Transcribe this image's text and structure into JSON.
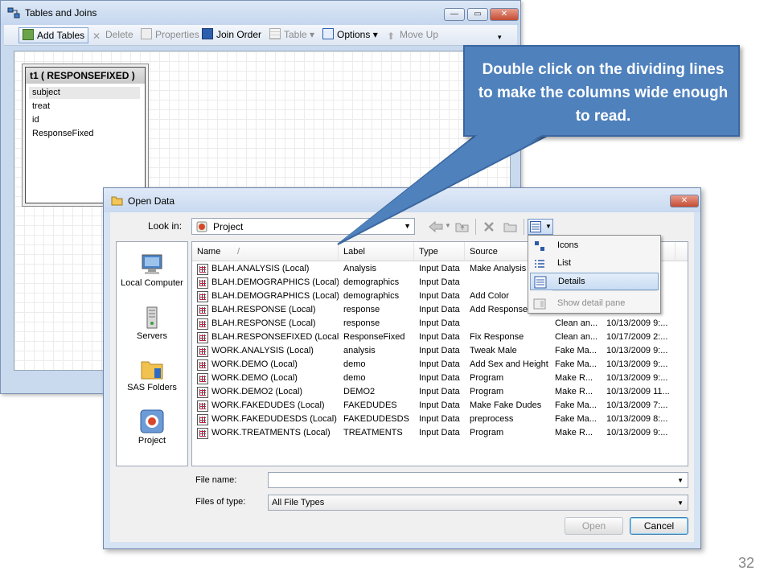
{
  "tables_window": {
    "title": "Tables and Joins",
    "toolbar": {
      "add_tables": "Add Tables",
      "delete": "Delete",
      "properties": "Properties",
      "join_order": "Join Order",
      "table": "Table",
      "options": "Options",
      "move_up": "Move Up"
    },
    "table_card": {
      "title": "t1 ( RESPONSEFIXED )",
      "columns": [
        "subject",
        "treat",
        "id",
        "ResponseFixed"
      ]
    }
  },
  "callout": {
    "text": "Double click on the dividing lines to make the columns wide enough  to read."
  },
  "open_dialog": {
    "title": "Open Data",
    "look_in_label": "Look in:",
    "look_in_value": "Project",
    "places": [
      "Local Computer",
      "Servers",
      "SAS Folders",
      "Project"
    ],
    "columns": [
      "Name",
      "Label",
      "Type",
      "Source"
    ],
    "sort_indicator": "/",
    "rows": [
      {
        "name": "BLAH.ANALYSIS (Local)",
        "label": "Analysis",
        "type": "Input Data",
        "source": "Make Analysis",
        "desc": "",
        "date": ""
      },
      {
        "name": "BLAH.DEMOGRAPHICS (Local)",
        "label": "demographics",
        "type": "Input Data",
        "source": "",
        "desc": "",
        "date": ""
      },
      {
        "name": "BLAH.DEMOGRAPHICS (Local)",
        "label": "demographics",
        "type": "Input Data",
        "source": "Add Color",
        "desc": "",
        "date": ""
      },
      {
        "name": "BLAH.RESPONSE (Local)",
        "label": "response",
        "type": "Input Data",
        "source": "Add Response",
        "desc": "",
        "date": ""
      },
      {
        "name": "BLAH.RESPONSE (Local)",
        "label": "response",
        "type": "Input Data",
        "source": "",
        "desc": "Clean an...",
        "date": "10/13/2009 9:..."
      },
      {
        "name": "BLAH.RESPONSEFIXED (Local)",
        "label": "ResponseFixed",
        "type": "Input Data",
        "source": "Fix Response",
        "desc": "Clean an...",
        "date": "10/17/2009 2:..."
      },
      {
        "name": "WORK.ANALYSIS (Local)",
        "label": "analysis",
        "type": "Input Data",
        "source": "Tweak Male",
        "desc": "Fake Ma...",
        "date": "10/13/2009 9:..."
      },
      {
        "name": "WORK.DEMO (Local)",
        "label": "demo",
        "type": "Input Data",
        "source": "Add Sex and Height",
        "desc": "Fake Ma...",
        "date": "10/13/2009 9:..."
      },
      {
        "name": "WORK.DEMO (Local)",
        "label": "demo",
        "type": "Input Data",
        "source": "Program",
        "desc": "Make R...",
        "date": "10/13/2009 9:..."
      },
      {
        "name": "WORK.DEMO2 (Local)",
        "label": "DEMO2",
        "type": "Input Data",
        "source": "Program",
        "desc": "Make R...",
        "date": "10/13/2009 11..."
      },
      {
        "name": "WORK.FAKEDUDES (Local)",
        "label": "FAKEDUDES",
        "type": "Input Data",
        "source": "Make Fake Dudes",
        "desc": "Fake Ma...",
        "date": "10/13/2009 7:..."
      },
      {
        "name": "WORK.FAKEDUDESDS (Local)",
        "label": "FAKEDUDESDS",
        "type": "Input Data",
        "source": "preprocess",
        "desc": "Fake Ma...",
        "date": "10/13/2009 8:..."
      },
      {
        "name": "WORK.TREATMENTS (Local)",
        "label": "TREATMENTS",
        "type": "Input Data",
        "source": "Program",
        "desc": "Make R...",
        "date": "10/13/2009 9:..."
      }
    ],
    "file_name_label": "File name:",
    "file_name_value": "",
    "file_type_label": "Files of type:",
    "file_type_value": "All File Types",
    "open_button": "Open",
    "cancel_button": "Cancel",
    "view_menu": {
      "items": [
        "Icons",
        "List",
        "Details",
        "Show detail pane"
      ],
      "selected": "Details"
    }
  },
  "page_number": "32"
}
